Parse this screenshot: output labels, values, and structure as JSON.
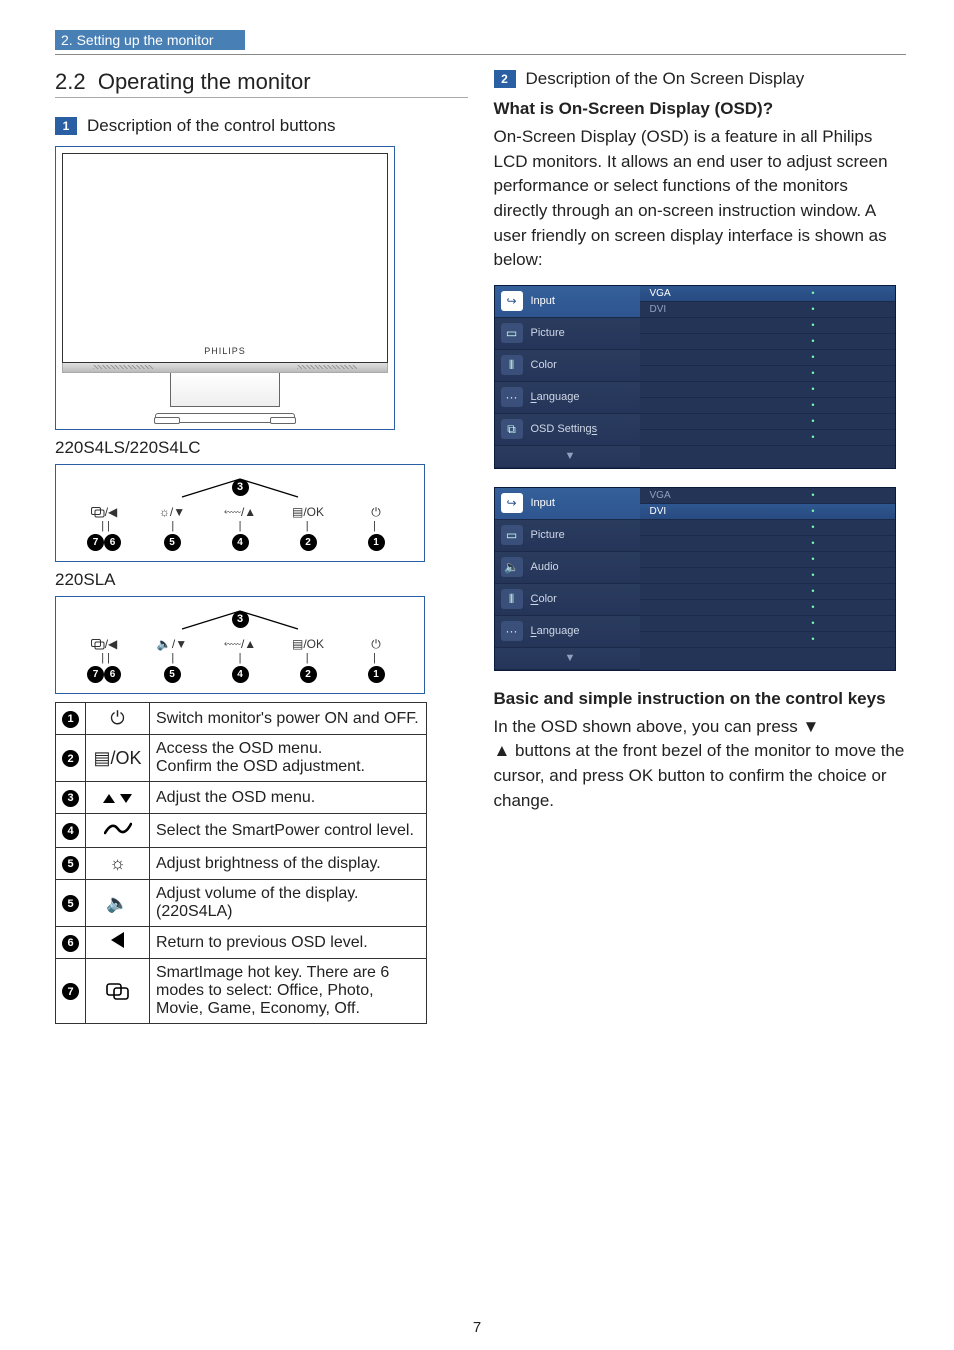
{
  "breadcrumb": "2. Setting up the monitor",
  "section_number": "2.2",
  "section_title": "Operating the monitor",
  "left": {
    "sub1_num": "1",
    "sub1_title": "Description of the control buttons",
    "brand": "PHILIPS",
    "model_a": "220S4LS/220S4LC",
    "model_b": "220SLA",
    "panel": {
      "top_badge": "3",
      "iconsA": [
        "⏿/◀",
        "☼/▼",
        "⬳/▲",
        "▤/OK",
        "⏻"
      ],
      "iconsB": [
        "⏿/◀",
        "🔈/▼",
        "⬳/▲",
        "▤/OK",
        "⏻"
      ],
      "numsA": [
        "7",
        "6",
        "5",
        "4",
        "2",
        "1"
      ],
      "numsB": [
        "7",
        "6",
        "5",
        "4",
        "2",
        "1"
      ]
    },
    "table": [
      {
        "n": "1",
        "icon": "⏻",
        "desc": "Switch monitor's power ON and OFF."
      },
      {
        "n": "2",
        "icon": "▤/OK",
        "desc": "Access the OSD menu.\nConfirm the OSD adjustment."
      },
      {
        "n": "3",
        "icon": "▲ ▼",
        "desc": "Adjust the OSD menu."
      },
      {
        "n": "4",
        "icon": "⬳",
        "desc": "Select the SmartPower control level."
      },
      {
        "n": "5",
        "icon": "☼",
        "desc": "Adjust brightness of the display."
      },
      {
        "n": "5b",
        "icon": "🔈",
        "desc": "Adjust volume of the display. (220S4LA)"
      },
      {
        "n": "6",
        "icon": "◀",
        "desc": "Return to previous OSD level."
      },
      {
        "n": "7",
        "icon": "SI",
        "desc": "SmartImage hot key. There are 6 modes to select: Office, Photo, Movie, Game, Economy, Off."
      }
    ]
  },
  "right": {
    "sub2_num": "2",
    "sub2_title": "Description of the On Screen Display",
    "q_title": "What is On-Screen Display (OSD)?",
    "q_para": "On-Screen Display (OSD) is a feature in all Philips LCD monitors. It allows an end user to adjust screen performance or select functions of the monitors directly through an on-screen instruction window. A user friendly on screen display interface is shown as below:",
    "osd1": {
      "menu": [
        {
          "glyph": "↪",
          "label": "Input",
          "active": true,
          "subs": [
            "VGA",
            "DVI"
          ]
        },
        {
          "glyph": "▭",
          "label": "Picture",
          "subs": [
            "",
            ""
          ]
        },
        {
          "glyph": "⦀",
          "label": "Color",
          "subs": [
            "",
            ""
          ]
        },
        {
          "glyph": "···",
          "label": "Language",
          "underline_first": true,
          "subs": [
            "",
            ""
          ]
        },
        {
          "glyph": "⧉",
          "label": "OSD Settings",
          "underline_last": true,
          "subs": [
            "",
            ""
          ]
        }
      ]
    },
    "osd2": {
      "menu": [
        {
          "glyph": "↪",
          "label": "Input",
          "active": true,
          "subs": [
            "VGA",
            "DVI"
          ],
          "active_sub": 1
        },
        {
          "glyph": "▭",
          "label": "Picture",
          "subs": [
            "",
            ""
          ]
        },
        {
          "glyph": "🔈",
          "label": "Audio",
          "subs": [
            "",
            ""
          ]
        },
        {
          "glyph": "⦀",
          "label": "Color",
          "underline_first": true,
          "subs": [
            "",
            ""
          ]
        },
        {
          "glyph": "···",
          "label": "Language",
          "underline_first": true,
          "subs": [
            "",
            ""
          ]
        }
      ]
    },
    "basic_title": "Basic and simple instruction on the control keys",
    "basic_para_1": "In the OSD shown above, you can press ▼",
    "basic_para_2": "▲ buttons at the front bezel of the monitor to move the cursor, and press OK button to confirm the choice or change."
  },
  "page_number": "7"
}
